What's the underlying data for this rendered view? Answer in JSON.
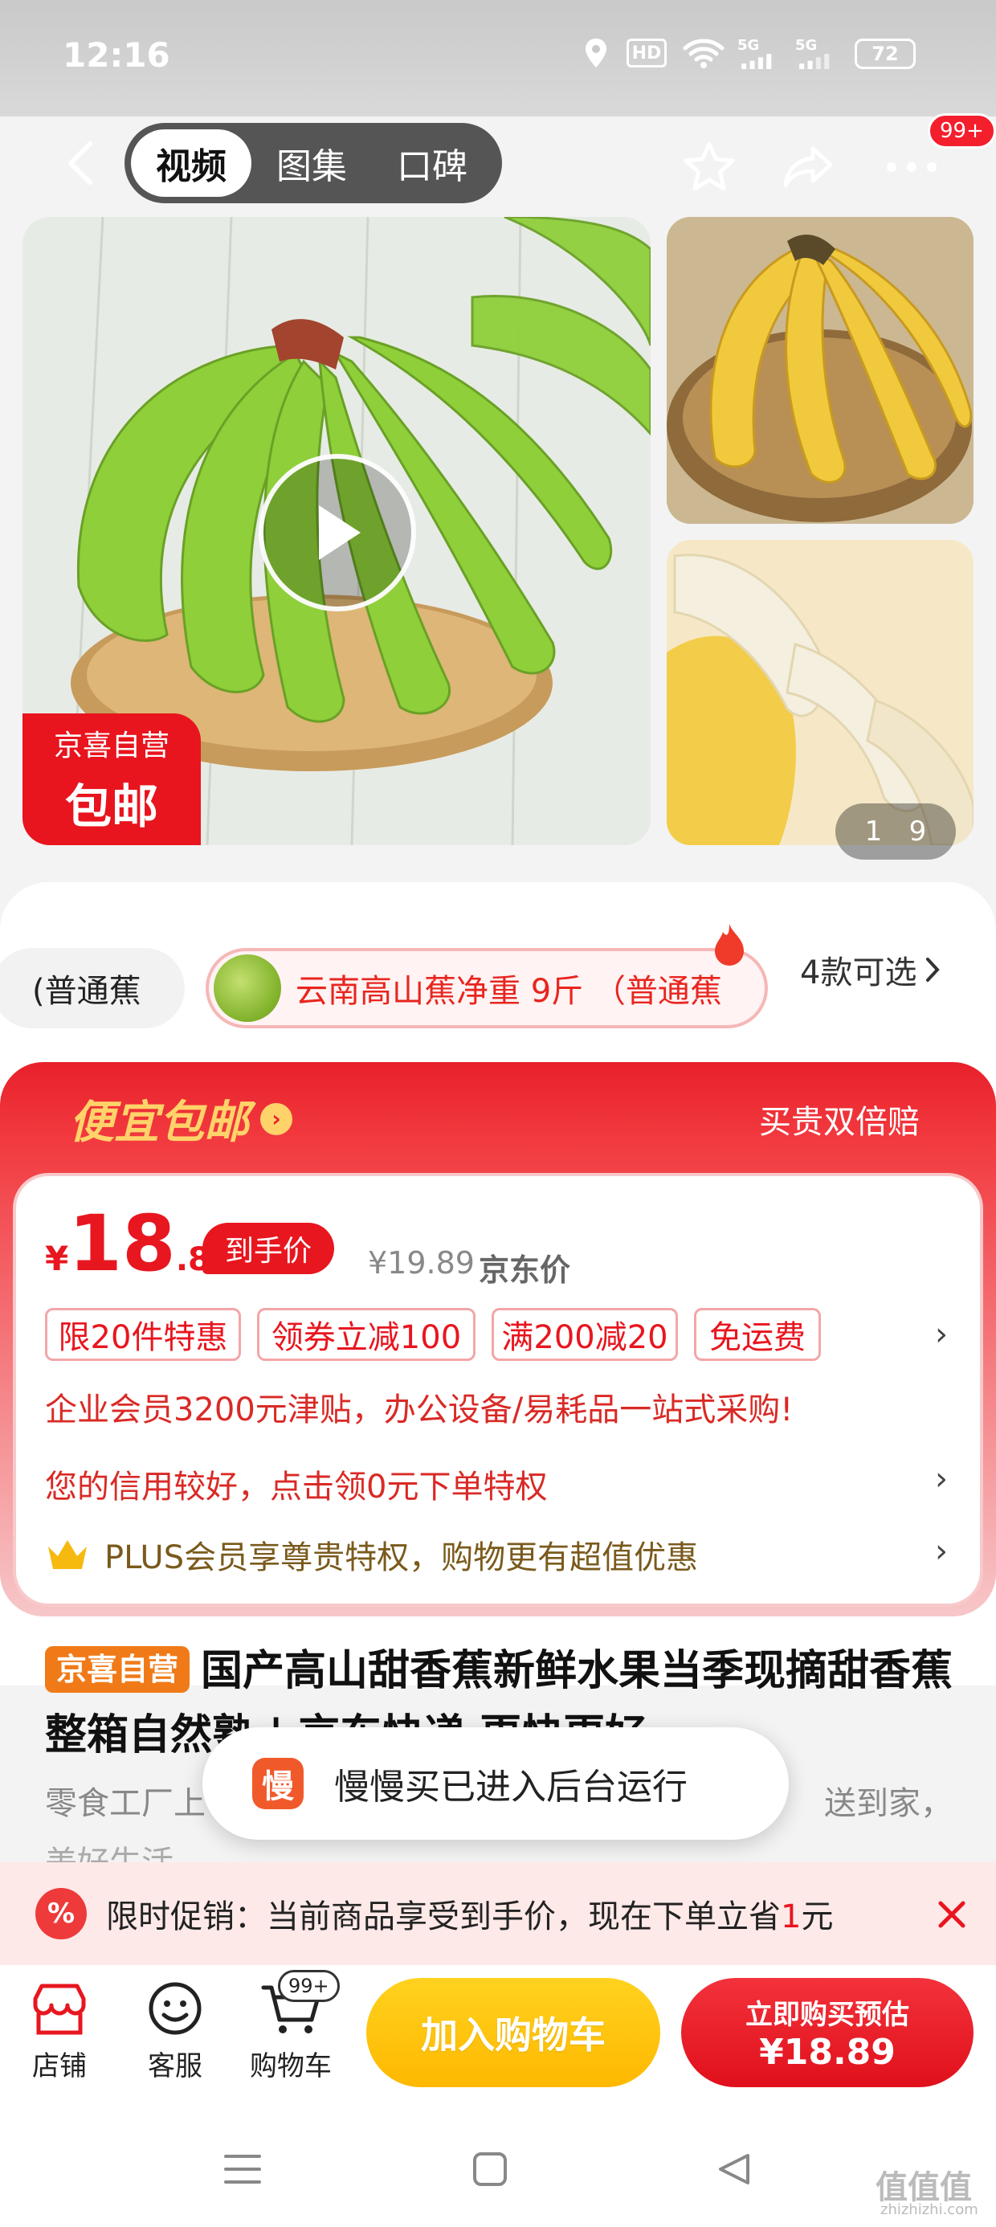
{
  "status_bar": {
    "time": "12:16",
    "hd": "HD",
    "signal1": "5G",
    "signal2": "5G",
    "battery": "72"
  },
  "header": {
    "tabs": [
      {
        "label": "视频",
        "active": true
      },
      {
        "label": "图集",
        "active": false
      },
      {
        "label": "口碑",
        "active": false
      }
    ],
    "more_badge": "99+"
  },
  "gallery": {
    "promo_tag_line1": "京喜自营",
    "promo_tag_line2": "包邮",
    "counter_current": "1",
    "counter_total": "9"
  },
  "variants": {
    "items": [
      "(普通蕉",
      "云南高山蕉净重 9斤 （普通蕉"
    ],
    "count_label": "4款可选"
  },
  "deal": {
    "title": "便宜包邮",
    "guarantee": "买贵双倍赔",
    "price_currency": "¥",
    "price_int": "18",
    "price_dec": ".89",
    "price_label": "到手价",
    "original_price": "¥19.89",
    "original_label": "京东价",
    "coupons": [
      "限20件特惠",
      "领券立减100",
      "满200减20",
      "免运费"
    ],
    "enterprise": "企业会员3200元津贴，办公设备/易耗品一站式采购!",
    "credit": "您的信用较好，点击领0元下单特权",
    "plus": "PLUS会员享尊贵特权，购物更有超值优惠"
  },
  "product": {
    "self_tag": "京喜自营",
    "title": "国产高山甜香蕉新鲜水果当季现摘甜香蕉整箱自然熟 | 京东快递 更快更好",
    "subtitle_left": "零食工厂上",
    "subtitle_right": "送到家，",
    "subtitle2": "美好生活"
  },
  "toast": {
    "app_icon_text": "慢",
    "message": "慢慢买已进入后台运行"
  },
  "promo_strip": {
    "icon_text": "%",
    "text_prefix": "限时促销：当前商品享受到手价，现在下单立省",
    "highlight": "1",
    "text_suffix": "元"
  },
  "bottom_bar": {
    "shop": "店铺",
    "service": "客服",
    "cart": "购物车",
    "cart_badge": "99+",
    "add_to_cart": "加入购物车",
    "buy_now_line1": "立即购买预估",
    "buy_now_line2": "¥18.89"
  },
  "watermark": {
    "text": "值值值",
    "sub": "zhizhizhi.com"
  },
  "colors": {
    "accent_red": "#e8161f",
    "yellow_button": "#ffc20e",
    "self_tag_orange": "#f07a18"
  }
}
